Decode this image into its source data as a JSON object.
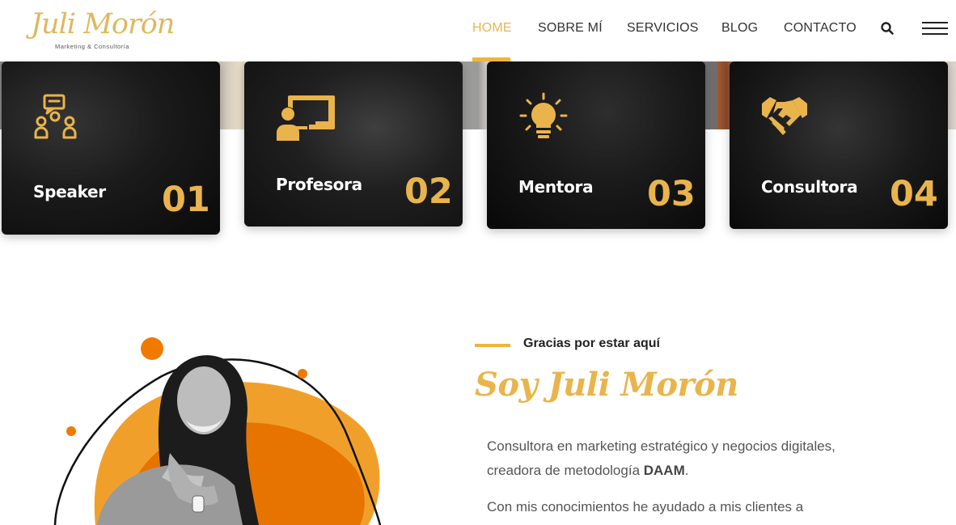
{
  "header": {
    "logo_text": "Juli Morón",
    "logo_subtitle": "Marketing & Consultoría",
    "nav": [
      {
        "label": "HOME",
        "active": true
      },
      {
        "label": "SOBRE MÍ",
        "active": false
      },
      {
        "label": "SERVICIOS",
        "active": false
      },
      {
        "label": "BLOG",
        "active": false
      },
      {
        "label": "CONTACTO",
        "active": false
      }
    ],
    "search_icon": "search-icon",
    "menu_icon": "hamburger-menu-icon"
  },
  "cards": [
    {
      "title": "Speaker",
      "number": "01",
      "icon": "speaker-chat-icon"
    },
    {
      "title": "Profesora",
      "number": "02",
      "icon": "teacher-board-icon"
    },
    {
      "title": "Mentora",
      "number": "03",
      "icon": "lightbulb-icon"
    },
    {
      "title": "Consultora",
      "number": "04",
      "icon": "handshake-icon"
    }
  ],
  "about": {
    "kicker": "Gracias por estar aquí",
    "heading": "Soy Juli Morón",
    "paragraph1_line1": "Consultora en marketing estratégico y negocios digitales,",
    "paragraph1_line2_prefix": "creadora de metodología ",
    "paragraph1_line2_bold": "DAAM",
    "paragraph1_line2_suffix": ".",
    "paragraph2_line1": "Con mis conocimientos he ayudado a mis clientes a"
  },
  "colors": {
    "accent": "#e9b44c",
    "orange": "#f07a00",
    "light_orange": "#f5a93a"
  }
}
